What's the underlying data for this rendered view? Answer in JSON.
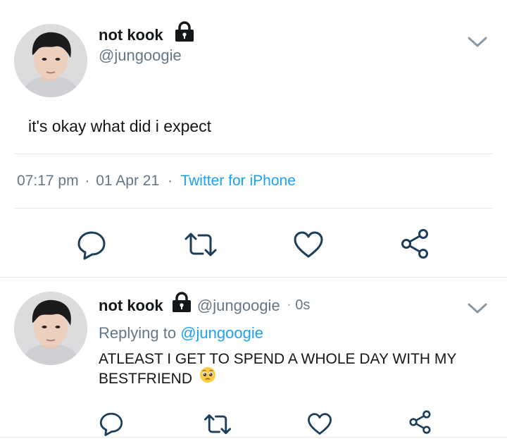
{
  "main_tweet": {
    "display_name": "not kook",
    "handle": "@jungoogie",
    "text": "it's okay what did i expect",
    "time": "07:17 pm",
    "date": "01 Apr 21",
    "separator": "·",
    "source": "Twitter for iPhone"
  },
  "reply_tweet": {
    "display_name": "not kook",
    "handle": "@jungoogie",
    "age": "0s",
    "separator": "·",
    "replying_prefix": "Replying to",
    "replying_handle": "@jungoogie",
    "text": "ATLEAST I GET TO SPEND A WHOLE DAY WITH MY BESTFRIEND",
    "emoji": "pleading-face"
  },
  "actions": [
    "reply-icon",
    "retweet-icon",
    "like-icon",
    "share-icon"
  ],
  "colors": {
    "text": "#14171a",
    "muted": "#657786",
    "link": "#1da1f2",
    "icon": "#1c3e5a",
    "divider": "#e1e8ed"
  }
}
